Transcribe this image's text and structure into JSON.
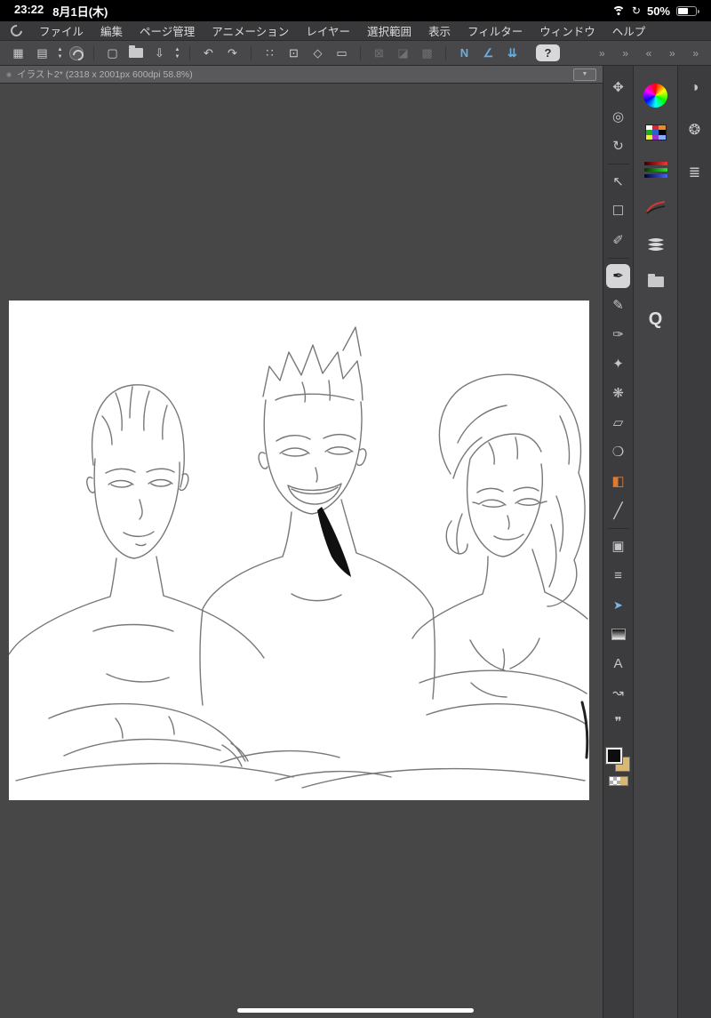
{
  "status_bar": {
    "time": "23:22",
    "date": "8月1日(木)",
    "battery_percent": "50%"
  },
  "menu_bar": {
    "items": [
      "ファイル",
      "編集",
      "ページ管理",
      "アニメーション",
      "レイヤー",
      "選択範囲",
      "表示",
      "フィルター",
      "ウィンドウ",
      "ヘルプ"
    ]
  },
  "command_bar": {
    "workspace": "▦",
    "page_manager": "▤",
    "stepper_up": "▲",
    "stepper_down": "▼",
    "new_canvas": "▢",
    "save": "⇩",
    "undo": "↶",
    "redo": "↷",
    "transform_dots": "∷",
    "transform_mesh": "⊡",
    "transform_rotate": "◇",
    "transform_frame": "▭",
    "disabled_1": "⊠",
    "disabled_2": "◪",
    "disabled_3": "▩",
    "snap_ruler": "N",
    "snap_special": "∠",
    "snap_grid": "⇊",
    "help": "?",
    "chev_1": "»",
    "chev_2": "»",
    "chev_3": "«",
    "chev_4": "»",
    "chev_5": "»"
  },
  "doc_tab": {
    "bullet": "◉",
    "title": "イラスト2* (2318 x 2001px 600dpi 58.8%)",
    "dropdown": "▼"
  },
  "tool_strip": {
    "pan": "✥",
    "zoom": "◎",
    "rotate": "↻",
    "operation": "↖",
    "marquee": "☐",
    "eyedropper": "✐",
    "pen": "✒",
    "pencil": "✎",
    "brush": "✑",
    "airbrush": "✦",
    "decoration": "❋",
    "eraser": "▱",
    "blend": "❍",
    "fill": "◧",
    "figure": "╱",
    "frame": "▣",
    "ruler": "≡",
    "object": "➤",
    "text": "A",
    "linefix": "↝",
    "balloon": "❞"
  },
  "palette_strip": {
    "navigator": "Q"
  },
  "edge_bar": {
    "mixer": "◑",
    "gear": "❂",
    "sliders": "≣"
  },
  "colors": {
    "accent_blue": "#6aaede",
    "fill_orange": "#de7b33",
    "foreground": "#0d0d0d",
    "background_color": "#d9b873"
  }
}
